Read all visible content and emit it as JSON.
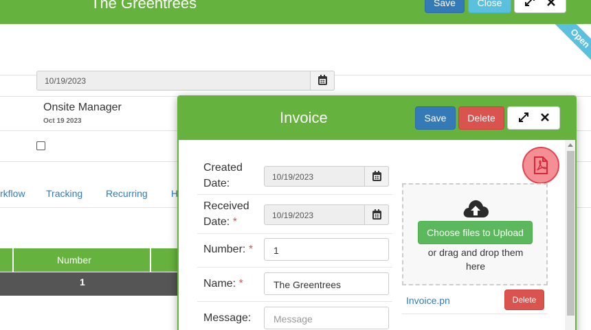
{
  "top_header": {
    "title": "The Greentrees",
    "save_label": "Save",
    "close_label": "Close"
  },
  "ribbon": {
    "label": "Open"
  },
  "background_form": {
    "date_value": "10/19/2023",
    "manager_name": "Onsite Manager",
    "manager_date": "Oct 19 2023"
  },
  "tabs": [
    "rkflow",
    "Tracking",
    "Recurring",
    "H"
  ],
  "table": {
    "header_number": "Number",
    "row_number": "1"
  },
  "modal": {
    "title": "Invoice",
    "save_label": "Save",
    "delete_label": "Delete",
    "fields": {
      "created_date_label_1": "Created",
      "created_date_label_2": "Date:",
      "created_date_value": "10/19/2023",
      "received_date_label_1": "Received",
      "received_date_label_2": "Date:",
      "received_date_value": "10/19/2023",
      "number_label": "Number:",
      "number_value": "1",
      "name_label": "Name:",
      "name_value": "The Greentrees",
      "message_label": "Message:",
      "message_placeholder": "Message",
      "required_mark": "*"
    },
    "upload": {
      "choose_label": "Choose files to Upload",
      "drop_text_1": "or drag and drop them",
      "drop_text_2": "here",
      "file_name": "Invoice.pn",
      "file_delete_label": "Delete"
    }
  },
  "icons": {
    "calendar": "calendar-icon",
    "expand": "expand-icon",
    "close": "close-icon",
    "cloud_upload": "cloud-upload-icon",
    "pdf": "file-pdf-icon"
  },
  "colors": {
    "header_green": "#66b23e",
    "primary": "#337ab7",
    "info": "#5bc0de",
    "danger": "#d9534f",
    "success": "#5cb85c",
    "pdf_circle": "#f49095"
  }
}
